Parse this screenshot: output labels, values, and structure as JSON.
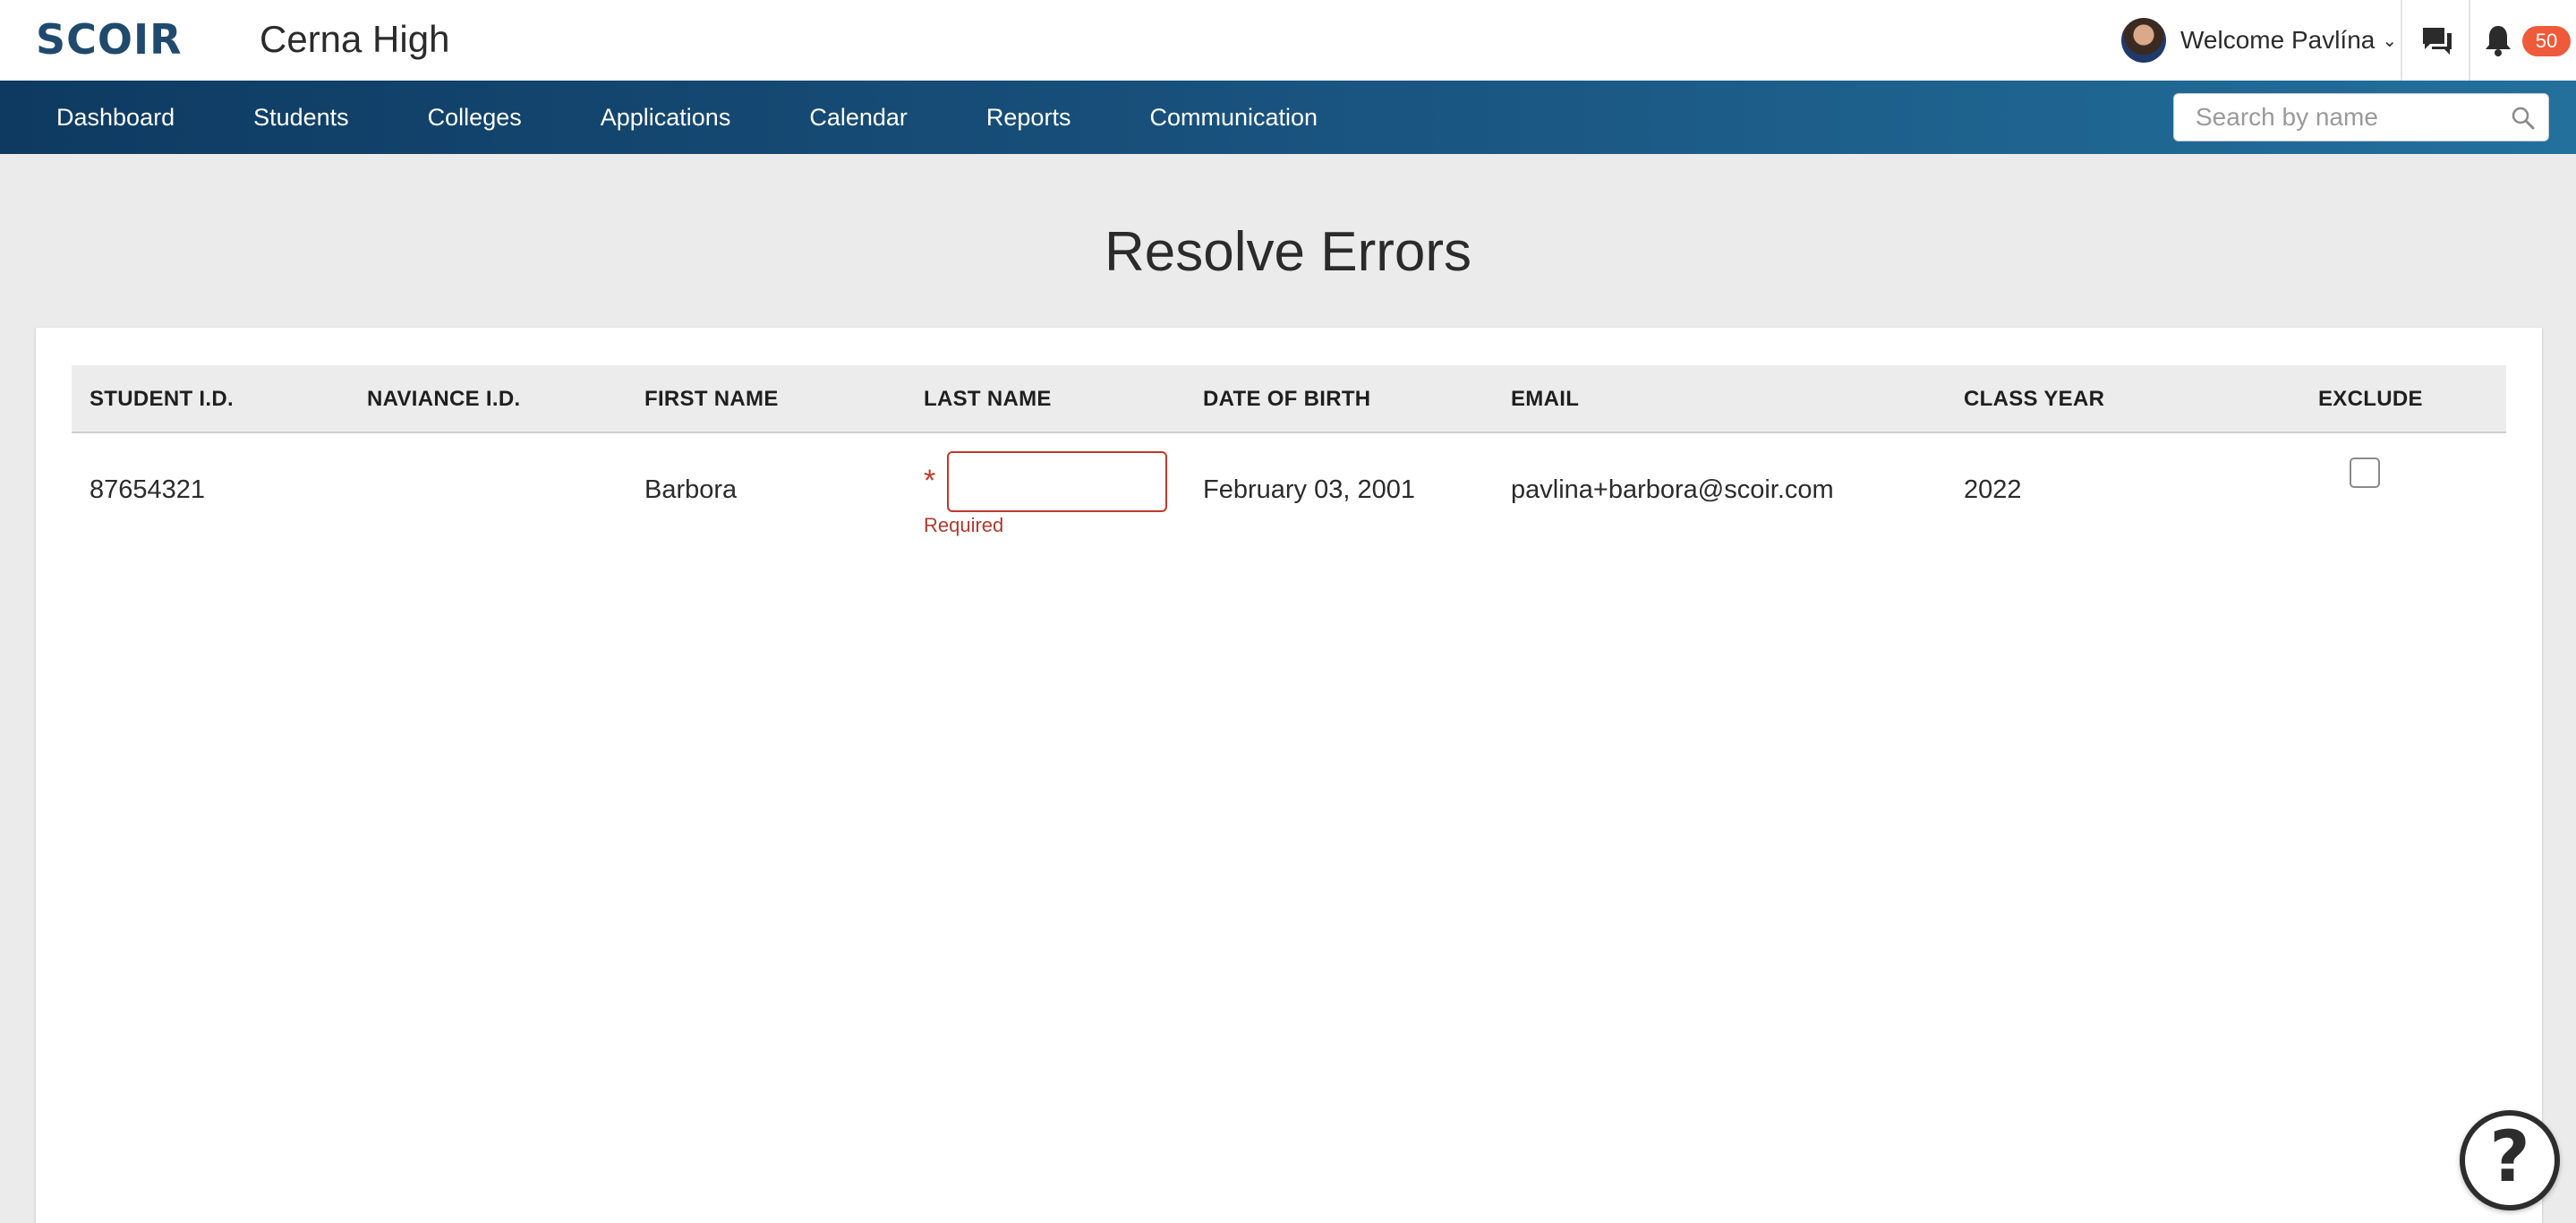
{
  "header": {
    "logo": "SCOIR",
    "school": "Cerna High",
    "welcome": "Welcome Pavlína",
    "notification_count": "50"
  },
  "nav": {
    "items": [
      {
        "label": "Dashboard"
      },
      {
        "label": "Students"
      },
      {
        "label": "Colleges"
      },
      {
        "label": "Applications"
      },
      {
        "label": "Calendar"
      },
      {
        "label": "Reports"
      },
      {
        "label": "Communication"
      }
    ],
    "search_placeholder": "Search by name"
  },
  "page": {
    "title": "Resolve Errors"
  },
  "table": {
    "headers": [
      "STUDENT I.D.",
      "NAVIANCE I.D.",
      "FIRST NAME",
      "LAST NAME",
      "DATE OF BIRTH",
      "EMAIL",
      "CLASS YEAR",
      "EXCLUDE"
    ],
    "rows": [
      {
        "student_id": "87654321",
        "naviance_id": "",
        "first_name": "Barbora",
        "last_name": "",
        "required_marker": "*",
        "error": "Required",
        "dob": "February 03, 2001",
        "email": "pavlina+barbora@scoir.com",
        "class_year": "2022",
        "exclude": false
      }
    ]
  },
  "colors": {
    "nav_start": "#0e3a61",
    "nav_end": "#23709d",
    "error": "#c0392b",
    "badge": "#ef5a3a",
    "logo": "#1f4a6e"
  },
  "icons": [
    "chevron-down-icon",
    "chat-icon",
    "bell-icon",
    "search-icon",
    "help-icon"
  ]
}
